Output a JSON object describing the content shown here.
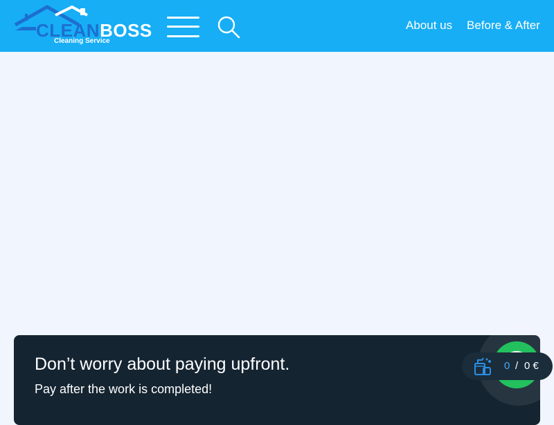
{
  "header": {
    "logo": {
      "word_clean": "CLEAN",
      "word_boss": "BOSS",
      "tagline": "Cleaning Service"
    },
    "menu_icon": "hamburger-menu-icon",
    "search_icon": "search-icon",
    "nav": {
      "about": "About us",
      "before_after": "Before & After"
    }
  },
  "banner": {
    "title": "Don’t worry about paying upfront.",
    "text": "Pay after the work is completed!"
  },
  "cart": {
    "icon": "cleaning-supplies-icon",
    "count": "0",
    "separator": "/",
    "total": "0 €"
  },
  "whatsapp": {
    "icon": "whatsapp-icon"
  },
  "colors": {
    "header_bg": "#17aef5",
    "logo_accent": "#1d6fcf",
    "page_bg": "#f1f5fd",
    "banner_bg": "#152431",
    "cart_pill_bg": "#1b2d3b",
    "cart_count": "#45a8f5",
    "whatsapp_green": "#22c15e"
  }
}
